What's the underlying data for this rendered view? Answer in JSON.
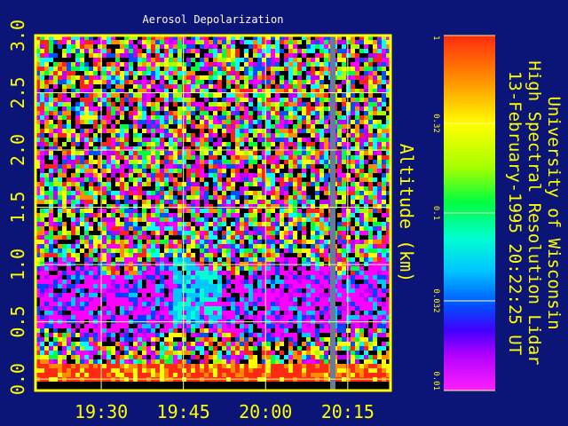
{
  "title": "Aerosol Depolarization",
  "side_title": {
    "line1": "University of Wisconsin",
    "line2": "High Spectral Resolution Lidar",
    "line3": "13-February-1995 20:22:25 UT"
  },
  "colors": {
    "background": "#0b1477",
    "frame": "#ffff00",
    "grid": "#ffff88",
    "label": "#ffff00",
    "title": "#ffffff"
  },
  "chart_data": {
    "type": "heatmap",
    "title": "Aerosol Depolarization",
    "ylabel": "Altitude (km)",
    "xlabel": "",
    "x_ticks": [
      "19:30",
      "19:45",
      "20:00",
      "20:15"
    ],
    "x_tick_positions": [
      19.5,
      19.75,
      20.0,
      20.25
    ],
    "xlim": [
      19.3,
      20.38
    ],
    "y_ticks": [
      "0.0",
      "0.5",
      "1.0",
      "1.5",
      "2.0",
      "2.5",
      "3.0"
    ],
    "y_tick_values": [
      0.0,
      0.5,
      1.0,
      1.5,
      2.0,
      2.5,
      3.0
    ],
    "ylim": [
      -0.1,
      3.0
    ],
    "grid": true,
    "colorbar": {
      "scale": "log",
      "tick_labels": [
        "1",
        "0.32",
        "0.1",
        "0.032",
        "0.01"
      ],
      "tick_values": [
        1,
        0.32,
        0.1,
        0.032,
        0.01
      ],
      "range": [
        0.01,
        1
      ]
    },
    "features": {
      "surface_layer_top_km": 0.15,
      "aerosol_layer_km": [
        0.5,
        1.0
      ],
      "missing_data_column_time": 20.2
    }
  }
}
